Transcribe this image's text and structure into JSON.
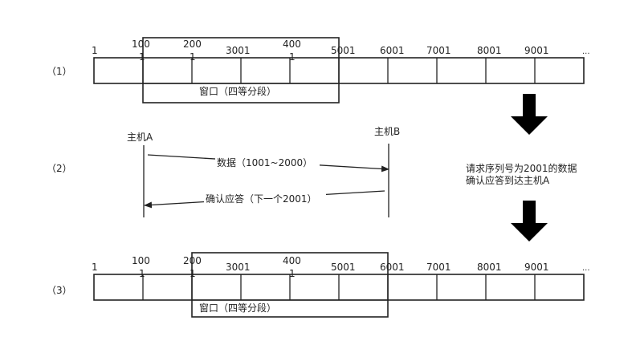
{
  "rows": {
    "r1": {
      "label": "（1）"
    },
    "r2": {
      "label": "（2）"
    },
    "r3": {
      "label": "（3）"
    }
  },
  "sequence_numbers": {
    "n1": "1",
    "n1001_top": "100",
    "n1001_bot": "1",
    "n2001_top": "200",
    "n2001_bot": "1",
    "n3001": "3001",
    "n4001_top": "400",
    "n4001_bot": "1",
    "n5001": "5001",
    "n6001": "6001",
    "n7001": "7001",
    "n8001": "8001",
    "n9001": "9001",
    "ellipsis": "..."
  },
  "window_label": "窗口（四等分段）",
  "hosts": {
    "a": "主机A",
    "b": "主机B"
  },
  "messages": {
    "data": "数据（1001~2000）",
    "ack": "确认应答（下一个2001）"
  },
  "note": {
    "line1": "请求序列号为2001的数据",
    "line2": "确认应答到达主机A"
  }
}
